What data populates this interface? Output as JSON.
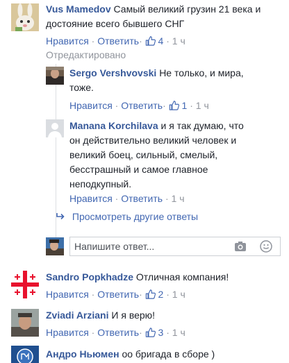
{
  "actions": {
    "like": "Нравится",
    "reply": "Ответить",
    "sep": "·"
  },
  "comments": [
    {
      "author": "Vus Mamedov",
      "lines": [
        "Самый великий грузин 21 века и",
        "достояние всего бывшего СНГ"
      ],
      "likes": "4",
      "time": "1 ч",
      "edited": "Отредактировано",
      "avatar_icon": "rabbit-avatar-icon"
    },
    {
      "author": "Sergo Vershvovski",
      "lines": [
        "Не только, и мира,",
        "тоже."
      ],
      "likes": "1",
      "time": "1 ч",
      "avatar_icon": "profile-photo-icon"
    },
    {
      "author": "Manana Korchilava",
      "lines": [
        "и я так думаю, что",
        "он действительно великий человек и",
        "великий боец, сильный, смелый,",
        "бесстрашный и самое главное",
        "неподкупный."
      ],
      "time": "1 ч",
      "avatar_icon": "default-avatar-icon"
    },
    {
      "author": "Sandro Popkhadze",
      "lines": [
        "Отличная компания!"
      ],
      "likes": "2",
      "time": "1 ч",
      "avatar_icon": "georgian-flag-icon"
    },
    {
      "author": "Zviadi Arziani",
      "lines": [
        "И я верю!"
      ],
      "likes": "3",
      "time": "1 ч",
      "avatar_icon": "profile-photo-icon"
    },
    {
      "author": "Андро Ньюмен",
      "lines": [
        "оо бригада в сборе )"
      ],
      "avatar_icon": "logo-avatar-icon"
    }
  ],
  "more_replies": "Просмотреть другие ответы",
  "reply_input": {
    "placeholder": "Напишите ответ..."
  },
  "colors": {
    "link": "#4267b2",
    "name": "#365899",
    "meta": "#90949c",
    "text": "#1d2129"
  }
}
